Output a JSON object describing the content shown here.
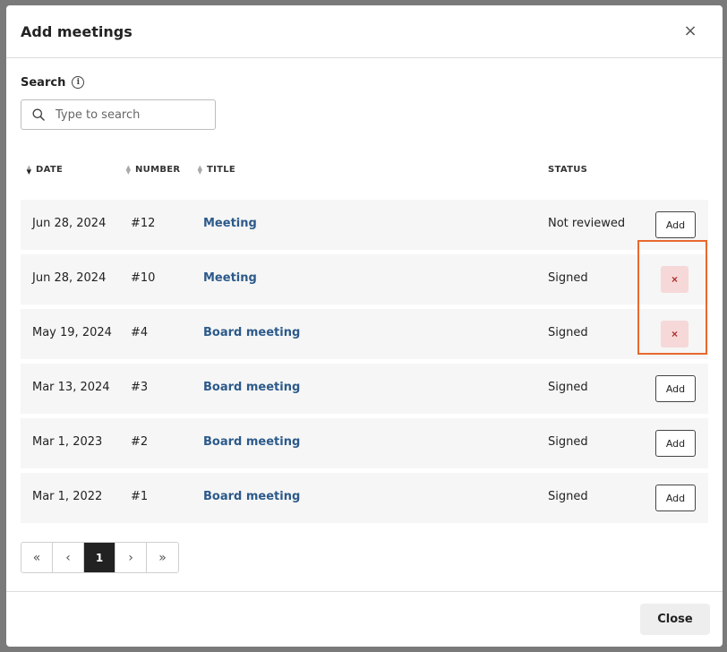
{
  "modal": {
    "title": "Add meetings",
    "close_icon": "×"
  },
  "search": {
    "label": "Search",
    "info_icon": "i",
    "placeholder": "Type to search"
  },
  "table": {
    "columns": {
      "date": "DATE",
      "number": "NUMBER",
      "title": "TITLE",
      "status": "STATUS"
    },
    "rows": [
      {
        "date": "Jun 28, 2024",
        "number": "#12",
        "title": "Meeting",
        "status": "Not reviewed",
        "action": "Add"
      },
      {
        "date": "Jun 28, 2024",
        "number": "#10",
        "title": "Meeting",
        "status": "Signed",
        "action": "×"
      },
      {
        "date": "May 19, 2024",
        "number": "#4",
        "title": "Board meeting",
        "status": "Signed",
        "action": "×"
      },
      {
        "date": "Mar 13, 2024",
        "number": "#3",
        "title": "Board meeting",
        "status": "Signed",
        "action": "Add"
      },
      {
        "date": "Mar 1, 2023",
        "number": "#2",
        "title": "Board meeting",
        "status": "Signed",
        "action": "Add"
      },
      {
        "date": "Mar 1, 2022",
        "number": "#1",
        "title": "Board meeting",
        "status": "Signed",
        "action": "Add"
      }
    ]
  },
  "pagination": {
    "first": "«",
    "prev": "‹",
    "current": "1",
    "next": "›",
    "last": "»"
  },
  "footer": {
    "close_label": "Close"
  },
  "colors": {
    "link": "#2c5a8a",
    "highlight": "#e8682f",
    "remove_bg": "#f6d8d8",
    "remove_fg": "#b03030"
  }
}
